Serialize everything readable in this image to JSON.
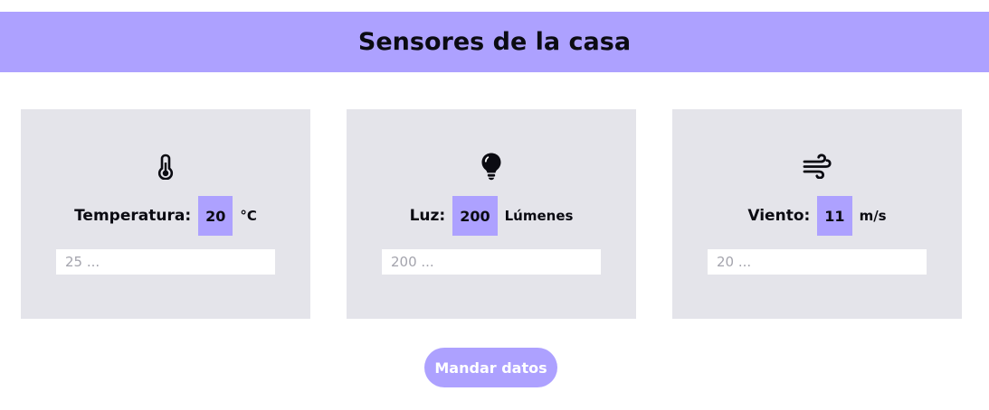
{
  "header": {
    "title": "Sensores de la casa"
  },
  "sensors": [
    {
      "icon": "thermometer-icon",
      "label": "Temperatura:",
      "value": "20",
      "unit": "°C",
      "placeholder": "25 ..."
    },
    {
      "icon": "lightbulb-icon",
      "label": "Luz:",
      "value": "200",
      "unit": "Lúmenes",
      "placeholder": "200 ..."
    },
    {
      "icon": "wind-icon",
      "label": "Viento:",
      "value": "11",
      "unit": "m/s",
      "placeholder": "20 ..."
    }
  ],
  "actions": {
    "send_label": "Mandar datos"
  },
  "colors": {
    "accent": "#ada1ff",
    "card_background": "#e4e4ea",
    "text": "#0b0b12",
    "button_text": "#ffffff",
    "placeholder": "#a4a4ad"
  }
}
